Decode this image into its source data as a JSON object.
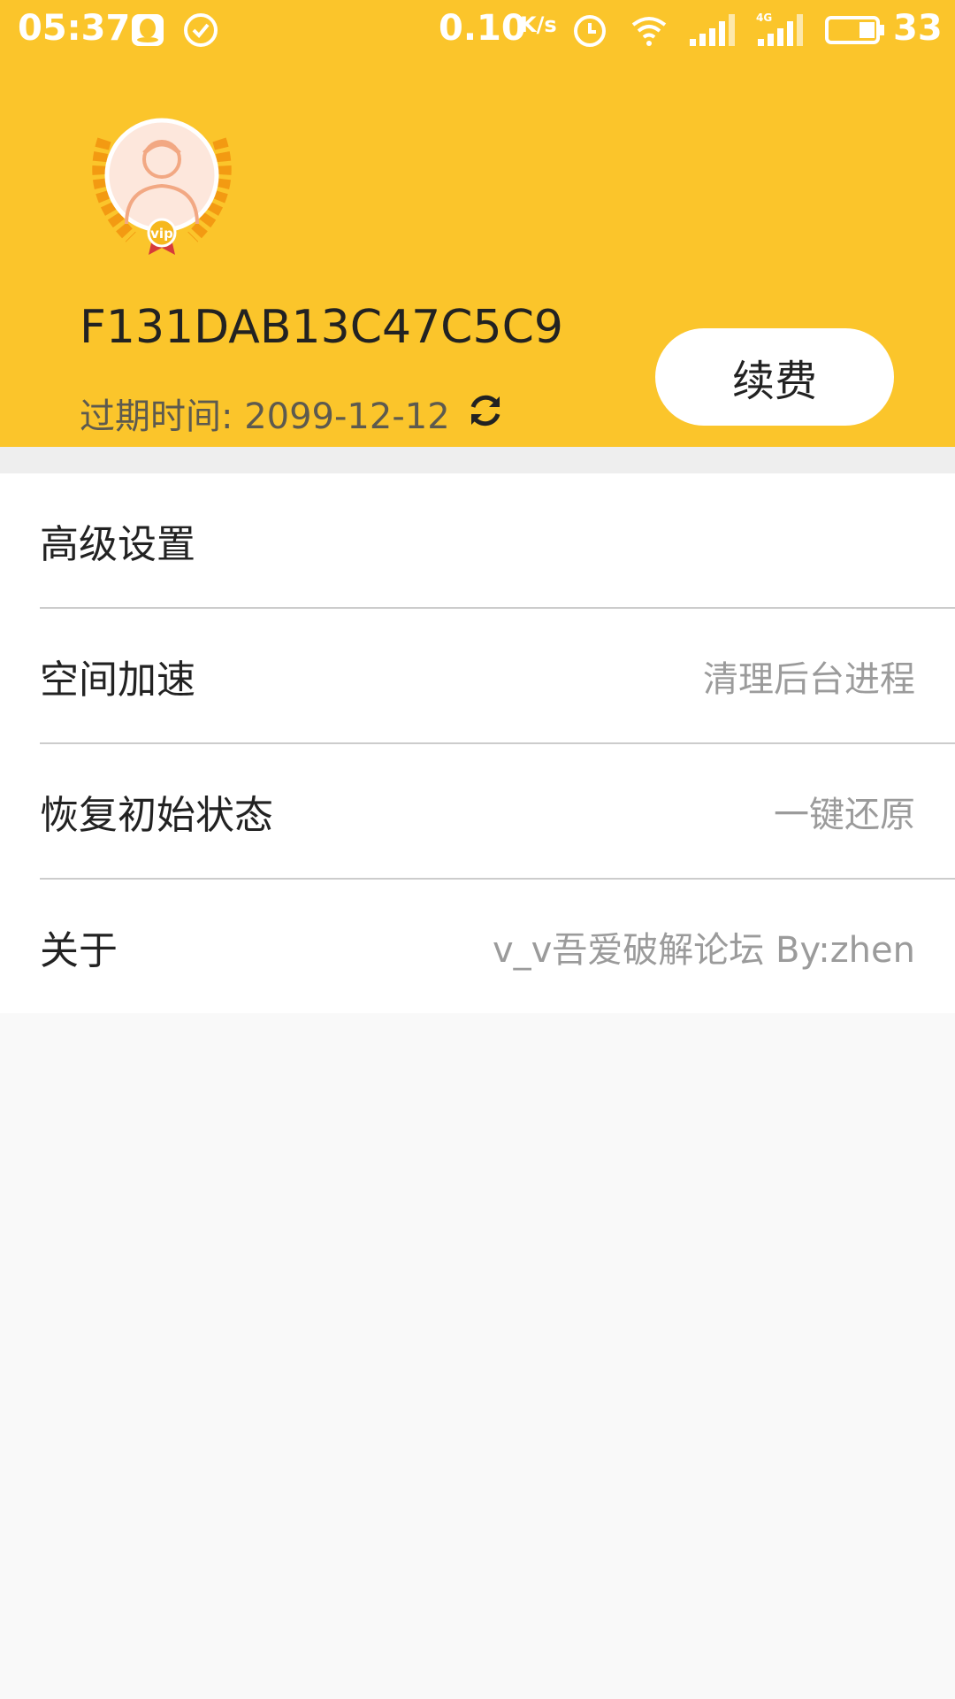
{
  "status_bar": {
    "time": "05:37",
    "net_speed": "0.10",
    "net_unit": "K/s",
    "battery": "33",
    "icons": [
      "qq-icon",
      "check-circle-icon",
      "alarm-icon",
      "wifi-icon",
      "signal-icon",
      "signal-4g-icon",
      "battery-icon"
    ]
  },
  "profile": {
    "user_id": "F131DAB13C47C5C9",
    "expire_label": "过期时间: 2099-12-12",
    "renew_button": "续费",
    "avatar_badge": "vip"
  },
  "menu": {
    "items": [
      {
        "label": "高级设置",
        "value": ""
      },
      {
        "label": "空间加速",
        "value": "清理后台进程"
      },
      {
        "label": "恢复初始状态",
        "value": "一键还原"
      },
      {
        "label": "关于",
        "value": "v_v吾爱破解论坛 By:zhen"
      }
    ]
  },
  "colors": {
    "header_bg": "#fbc52b",
    "page_bg": "#f9f9f9"
  }
}
